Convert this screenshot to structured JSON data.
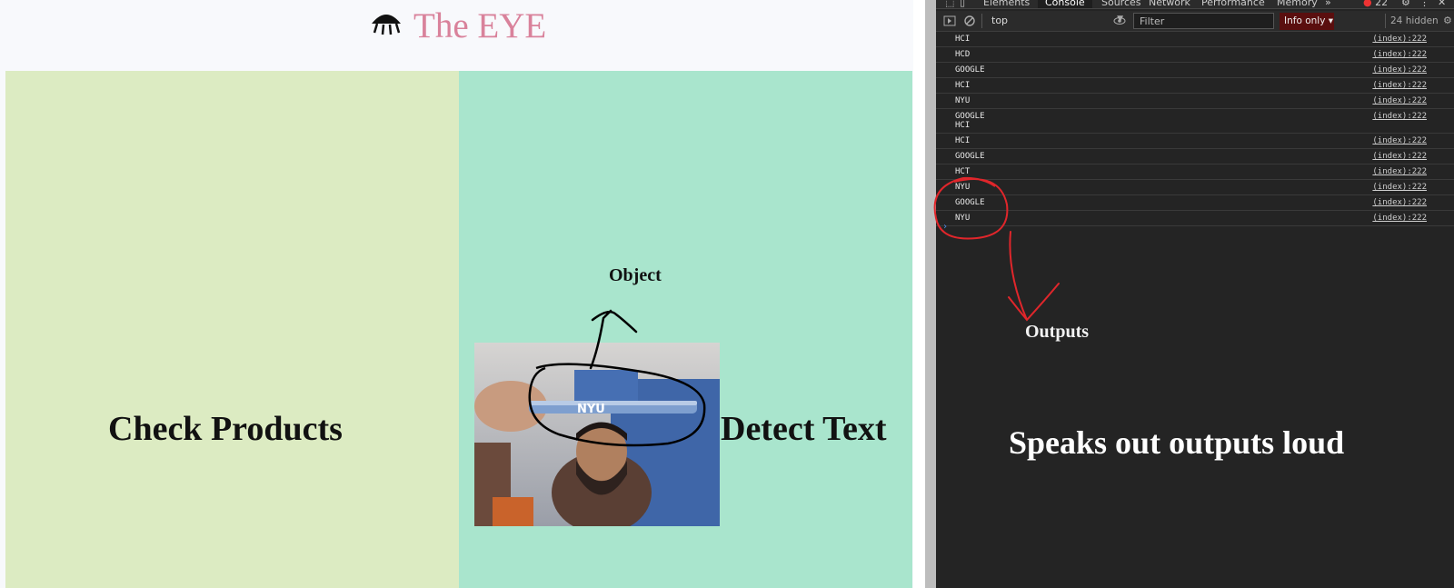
{
  "site": {
    "title": "The EYE",
    "panels": [
      {
        "label": "Check Products",
        "color": "#dcebc2"
      },
      {
        "label": "Detect Text",
        "color": "#a9e5cd"
      }
    ],
    "camera_pen_text": "NYU"
  },
  "annotations": {
    "object": "Object",
    "outputs": "Outputs",
    "speaks": "Speaks out outputs loud"
  },
  "devtools": {
    "tabs": [
      "Elements",
      "Console",
      "Sources",
      "Network",
      "Performance",
      "Memory",
      "»"
    ],
    "active_tab": "Console",
    "error_count": "22",
    "context": "top",
    "filter_placeholder": "Filter",
    "level": "Info only",
    "hidden": "24 hidden",
    "logs": [
      {
        "text": "HCI",
        "source": "(index):222"
      },
      {
        "text": "HCD",
        "source": "(index):222"
      },
      {
        "text": "GOOGLE",
        "source": "(index):222"
      },
      {
        "text": "HCI",
        "source": "(index):222"
      },
      {
        "text": "NYU",
        "source": "(index):222"
      },
      {
        "text": "GOOGLE\nHCI",
        "source": "(index):222"
      },
      {
        "text": "HCI",
        "source": "(index):222"
      },
      {
        "text": "GOOGLE",
        "source": "(index):222"
      },
      {
        "text": "HCT",
        "source": "(index):222"
      },
      {
        "text": "NYU",
        "source": "(index):222"
      },
      {
        "text": "GOOGLE",
        "source": "(index):222"
      },
      {
        "text": "NYU",
        "source": "(index):222"
      }
    ],
    "prompt": "›"
  },
  "colors": {
    "title": "#d9829b",
    "devtools_bg": "#242424",
    "annotation_red": "#e0262b"
  }
}
